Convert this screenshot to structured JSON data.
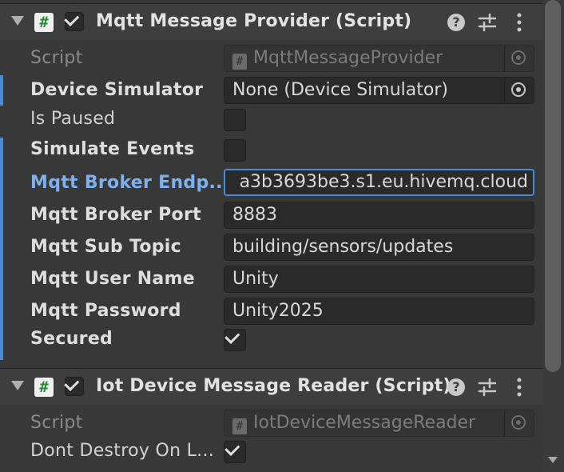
{
  "components": [
    {
      "title": "Mqtt Message Provider (Script)",
      "script_label": "Script",
      "script_value": "MqttMessageProvider",
      "fields": {
        "device_simulator": {
          "label": "Device Simulator",
          "value": "None (Device Simulator)"
        },
        "is_paused": {
          "label": "Is Paused",
          "checked": false
        },
        "simulate_events": {
          "label": "Simulate Events",
          "checked": false
        },
        "broker_endpoint": {
          "label": "Mqtt Broker Endp...",
          "value": "a3b3693be3.s1.eu.hivemq.cloud"
        },
        "broker_port": {
          "label": "Mqtt Broker Port",
          "value": "8883"
        },
        "sub_topic": {
          "label": "Mqtt Sub Topic",
          "value": "building/sensors/updates"
        },
        "user_name": {
          "label": "Mqtt User Name",
          "value": "Unity"
        },
        "password": {
          "label": "Mqtt Password",
          "value": "Unity2025"
        },
        "secured": {
          "label": "Secured",
          "checked": true
        }
      }
    },
    {
      "title": "Iot Device Message Reader (Script)",
      "script_label": "Script",
      "script_value": "IotDeviceMessageReader",
      "fields": {
        "dont_destroy": {
          "label": "Dont Destroy On L...",
          "checked": true
        }
      }
    }
  ],
  "icons": {
    "script": "#",
    "help": "?",
    "fold": "triangle-down",
    "presets": "sliders",
    "menu": "kebab"
  },
  "colors": {
    "accent": "#4b8bd6",
    "focus_label": "#7fb0ee",
    "background": "#383838"
  }
}
